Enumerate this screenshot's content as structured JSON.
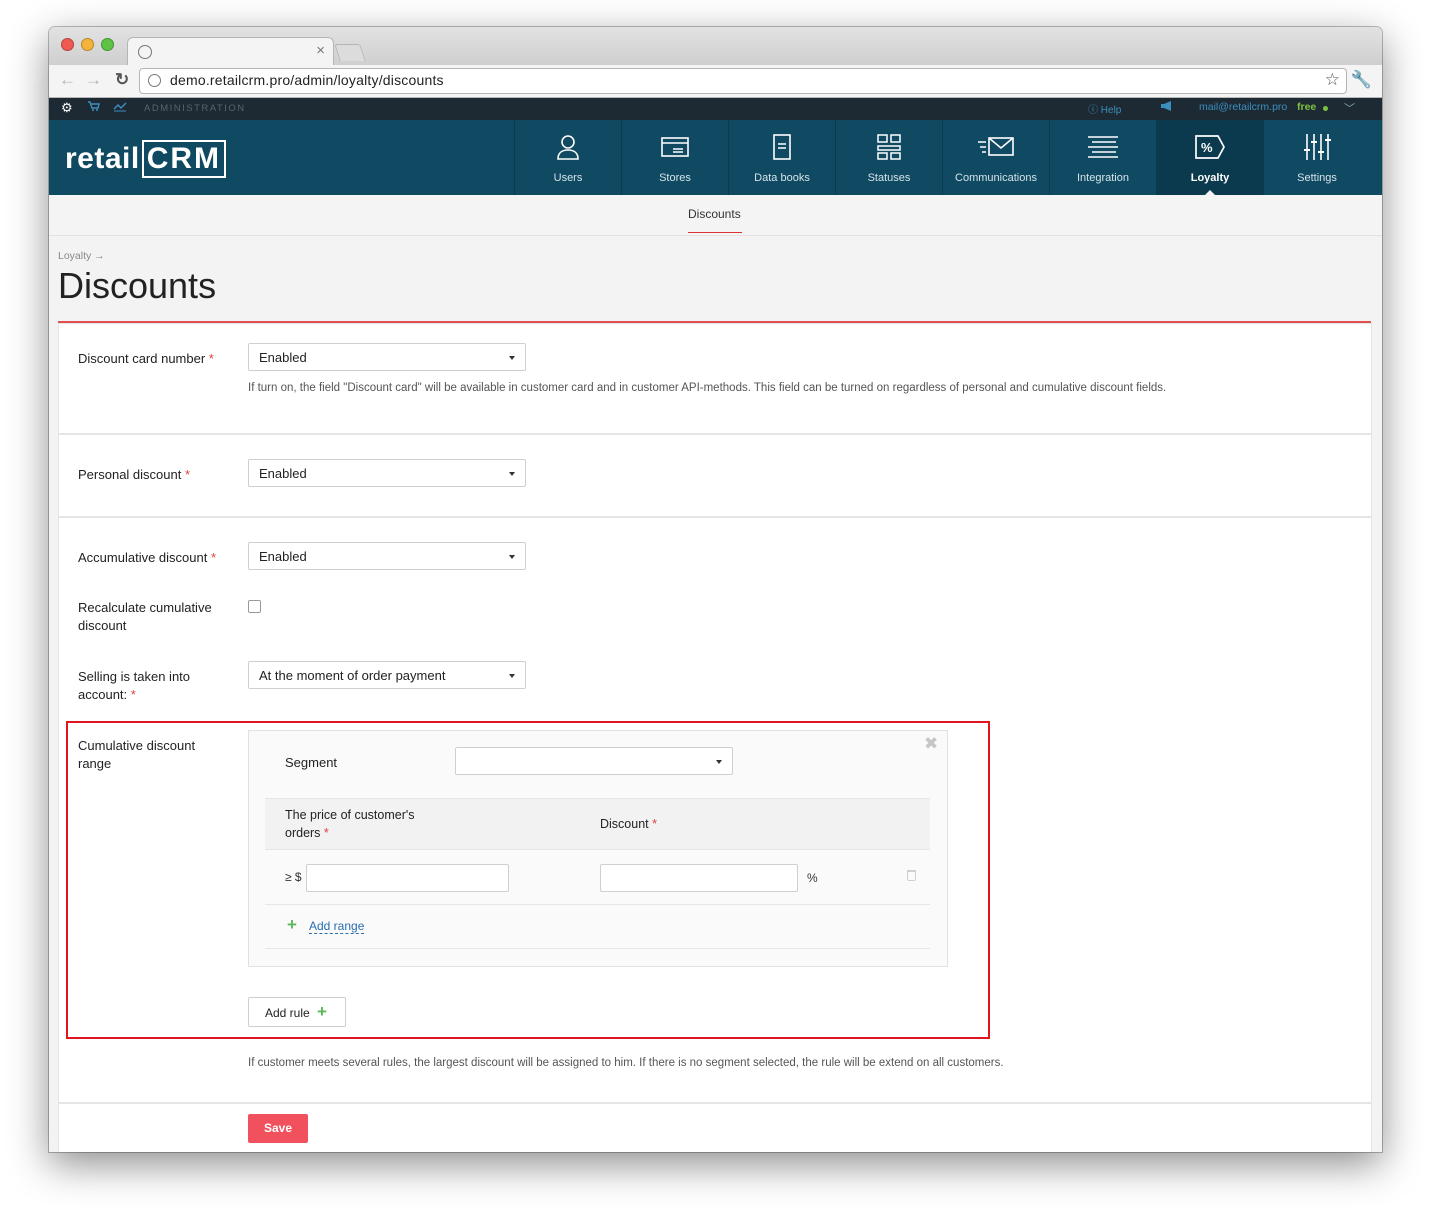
{
  "browser": {
    "url": "demo.retailcrm.pro/admin/loyalty/discounts"
  },
  "topbar": {
    "section": "ADMINISTRATION",
    "help": "Help",
    "user_email": "mail@retailcrm.pro",
    "plan": "free"
  },
  "logo": {
    "text_left": "retail",
    "text_right": "CRM"
  },
  "nav": {
    "items": [
      {
        "label": "Users",
        "icon": "user-icon"
      },
      {
        "label": "Stores",
        "icon": "store-icon"
      },
      {
        "label": "Data books",
        "icon": "book-icon"
      },
      {
        "label": "Statuses",
        "icon": "statuses-icon"
      },
      {
        "label": "Communications",
        "icon": "mail-icon"
      },
      {
        "label": "Integration",
        "icon": "integration-icon"
      },
      {
        "label": "Loyalty",
        "icon": "percent-tag-icon",
        "active": true
      },
      {
        "label": "Settings",
        "icon": "sliders-icon"
      }
    ]
  },
  "subnav": {
    "active": "Discounts"
  },
  "page": {
    "breadcrumb": "Loyalty →",
    "title": "Discounts"
  },
  "form": {
    "card_number": {
      "label": "Discount card number",
      "value": "Enabled",
      "hint": "If turn on, the field \"Discount card\" will be available in customer card and in customer API-methods. This field can be turned on regardless of personal and cumulative discount fields."
    },
    "personal": {
      "label": "Personal discount",
      "value": "Enabled"
    },
    "accumulative": {
      "label": "Accumulative discount",
      "value": "Enabled"
    },
    "recalculate": {
      "label_line1": "Recalculate cumulative",
      "label_line2": "discount",
      "checked": false
    },
    "selling": {
      "label_line1": "Selling is taken into",
      "label_line2": "account:",
      "value": "At the moment of order payment"
    },
    "range": {
      "label_line1": "Cumulative discount",
      "label_line2": "range",
      "segment_label": "Segment",
      "segment_value": "",
      "col_price_line1": "The price of customer's",
      "col_price_line2": "orders",
      "col_discount": "Discount",
      "prefix": "≥ $",
      "suffix": "%",
      "price_value": "",
      "discount_value": "",
      "add_range": "Add range",
      "add_rule": "Add rule",
      "hint": "If customer meets several rules, the largest discount will be assigned to him. If there is no segment selected, the rule will be extend on all customers."
    },
    "save": "Save"
  },
  "colors": {
    "header_bg": "#0f4a62",
    "topbar_bg": "#1e2a33",
    "accent_red": "#f0515d",
    "highlight_red": "#e0141e",
    "link_blue": "#2a6eb0",
    "plus_green": "#5cb85c"
  }
}
